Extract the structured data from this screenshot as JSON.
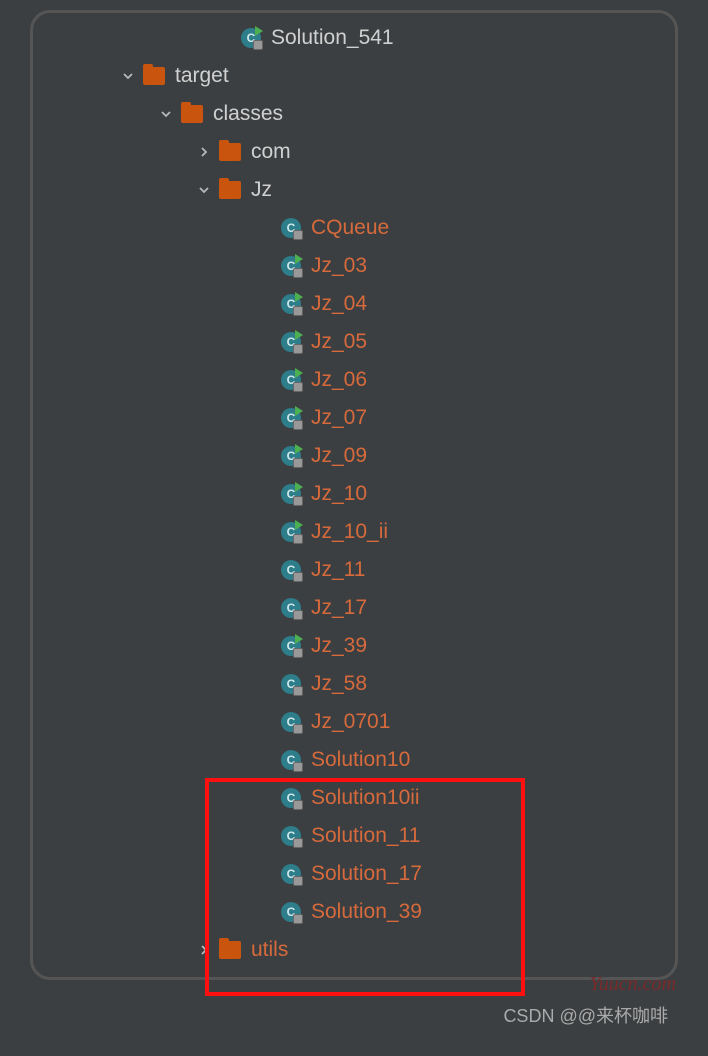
{
  "tree": {
    "top_file": {
      "name": "Solution_541",
      "icon": "class",
      "runnable": true,
      "locked": true,
      "indent": 208
    },
    "nodes": [
      {
        "label": "target",
        "type": "folder",
        "chevron": "down",
        "indent": 110,
        "color": "normal"
      },
      {
        "label": "classes",
        "type": "folder",
        "chevron": "down",
        "indent": 148,
        "color": "normal"
      },
      {
        "label": "com",
        "type": "folder",
        "chevron": "right",
        "indent": 186,
        "color": "normal"
      },
      {
        "label": "Jz",
        "type": "folder",
        "chevron": "down",
        "indent": 186,
        "color": "normal"
      },
      {
        "label": "CQueue",
        "type": "class",
        "runnable": false,
        "locked": true,
        "indent": 248,
        "color": "vcs"
      },
      {
        "label": "Jz_03",
        "type": "class",
        "runnable": true,
        "locked": true,
        "indent": 248,
        "color": "vcs"
      },
      {
        "label": "Jz_04",
        "type": "class",
        "runnable": true,
        "locked": true,
        "indent": 248,
        "color": "vcs"
      },
      {
        "label": "Jz_05",
        "type": "class",
        "runnable": true,
        "locked": true,
        "indent": 248,
        "color": "vcs"
      },
      {
        "label": "Jz_06",
        "type": "class",
        "runnable": true,
        "locked": true,
        "indent": 248,
        "color": "vcs"
      },
      {
        "label": "Jz_07",
        "type": "class",
        "runnable": true,
        "locked": true,
        "indent": 248,
        "color": "vcs"
      },
      {
        "label": "Jz_09",
        "type": "class",
        "runnable": true,
        "locked": true,
        "indent": 248,
        "color": "vcs"
      },
      {
        "label": "Jz_10",
        "type": "class",
        "runnable": true,
        "locked": true,
        "indent": 248,
        "color": "vcs"
      },
      {
        "label": "Jz_10_ii",
        "type": "class",
        "runnable": true,
        "locked": true,
        "indent": 248,
        "color": "vcs"
      },
      {
        "label": "Jz_11",
        "type": "class",
        "runnable": false,
        "locked": true,
        "indent": 248,
        "color": "vcs"
      },
      {
        "label": "Jz_17",
        "type": "class",
        "runnable": false,
        "locked": true,
        "indent": 248,
        "color": "vcs"
      },
      {
        "label": "Jz_39",
        "type": "class",
        "runnable": true,
        "locked": true,
        "indent": 248,
        "color": "vcs"
      },
      {
        "label": "Jz_58",
        "type": "class",
        "runnable": false,
        "locked": true,
        "indent": 248,
        "color": "vcs"
      },
      {
        "label": "Jz_0701",
        "type": "class",
        "runnable": false,
        "locked": true,
        "indent": 248,
        "color": "vcs"
      },
      {
        "label": "Solution10",
        "type": "class",
        "runnable": false,
        "locked": true,
        "indent": 248,
        "color": "vcs"
      },
      {
        "label": "Solution10ii",
        "type": "class",
        "runnable": false,
        "locked": true,
        "indent": 248,
        "color": "vcs"
      },
      {
        "label": "Solution_11",
        "type": "class",
        "runnable": false,
        "locked": true,
        "indent": 248,
        "color": "vcs"
      },
      {
        "label": "Solution_17",
        "type": "class",
        "runnable": false,
        "locked": true,
        "indent": 248,
        "color": "vcs"
      },
      {
        "label": "Solution_39",
        "type": "class",
        "runnable": false,
        "locked": true,
        "indent": 248,
        "color": "vcs"
      },
      {
        "label": "utils",
        "type": "folder",
        "chevron": "right",
        "indent": 186,
        "color": "vcs"
      }
    ]
  },
  "watermark1": "Yuucn.com",
  "watermark2": "CSDN @@来杯咖啡"
}
